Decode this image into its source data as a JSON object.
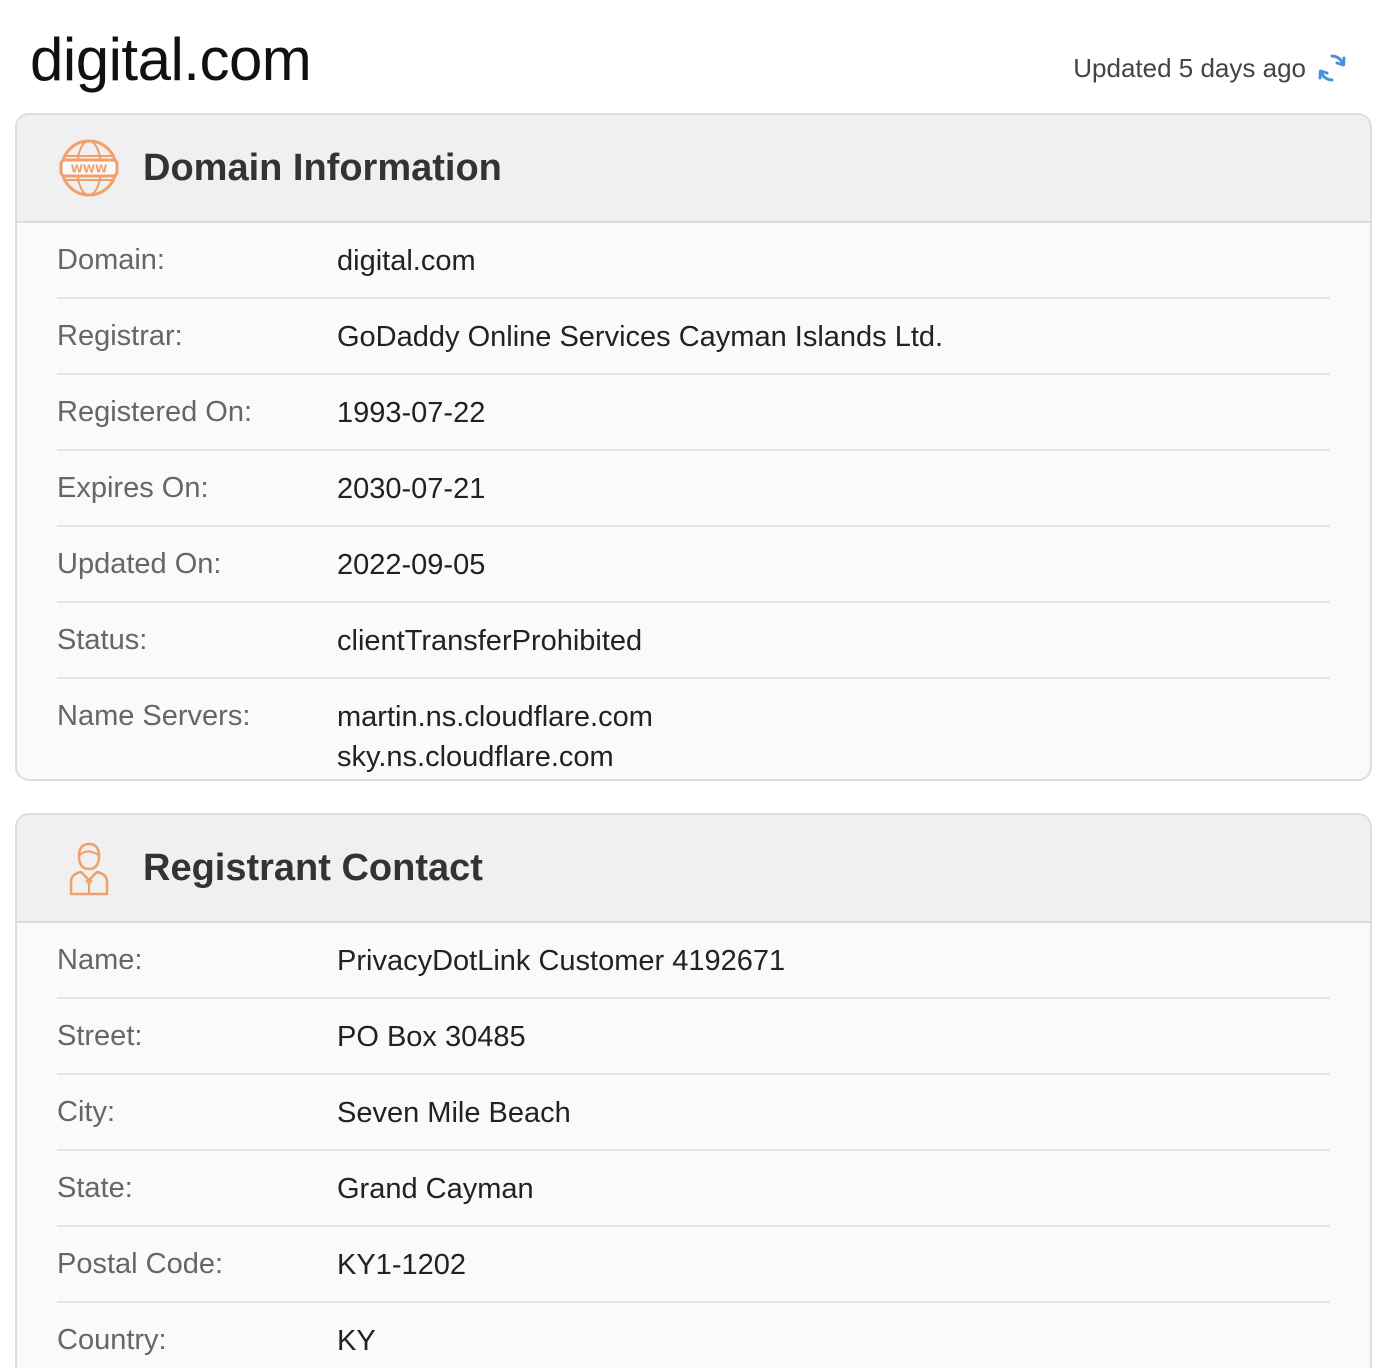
{
  "header": {
    "title": "digital.com",
    "updated_text": "Updated 5 days ago"
  },
  "domain_info": {
    "title": "Domain Information",
    "icon": "www-globe-icon",
    "rows": [
      {
        "label": "Domain:",
        "value": "digital.com"
      },
      {
        "label": "Registrar:",
        "value": "GoDaddy Online Services Cayman Islands Ltd."
      },
      {
        "label": "Registered On:",
        "value": "1993-07-22"
      },
      {
        "label": "Expires On:",
        "value": "2030-07-21"
      },
      {
        "label": "Updated On:",
        "value": "2022-09-05"
      },
      {
        "label": "Status:",
        "value": "clientTransferProhibited"
      },
      {
        "label": "Name Servers:",
        "values": [
          "martin.ns.cloudflare.com",
          "sky.ns.cloudflare.com"
        ]
      }
    ]
  },
  "registrant": {
    "title": "Registrant Contact",
    "icon": "person-icon",
    "rows": [
      {
        "label": "Name:",
        "value": "PrivacyDotLink Customer 4192671"
      },
      {
        "label": "Street:",
        "value": "PO Box 30485"
      },
      {
        "label": "City:",
        "value": "Seven Mile Beach"
      },
      {
        "label": "State:",
        "value": "Grand Cayman"
      },
      {
        "label": "Postal Code:",
        "value": "KY1-1202"
      },
      {
        "label": "Country:",
        "value": "KY"
      }
    ]
  },
  "colors": {
    "accent_icon": "#f0a06a",
    "refresh_icon": "#4a90e2"
  }
}
